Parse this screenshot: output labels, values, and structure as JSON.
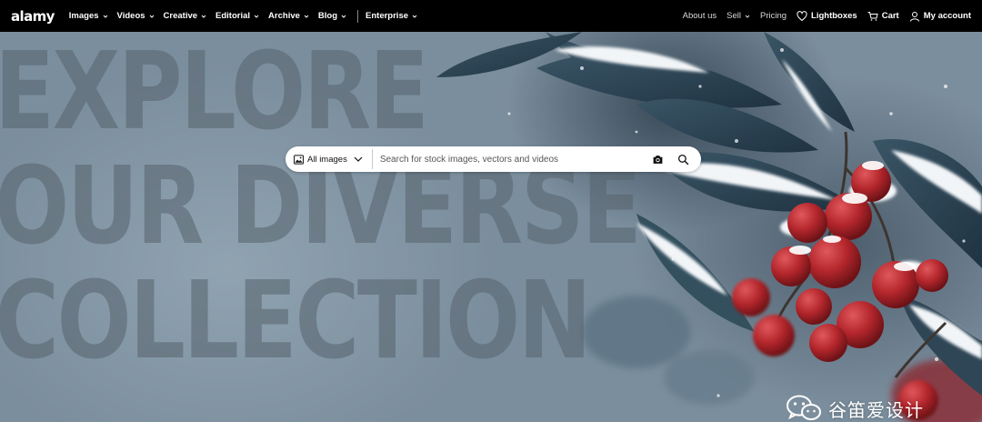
{
  "brand": {
    "logo_text": "alamy"
  },
  "nav": {
    "left": [
      {
        "label": "Images",
        "dropdown": true
      },
      {
        "label": "Videos",
        "dropdown": true
      },
      {
        "label": "Creative",
        "dropdown": true
      },
      {
        "label": "Editorial",
        "dropdown": true
      },
      {
        "label": "Archive",
        "dropdown": true
      },
      {
        "label": "Blog",
        "dropdown": true
      },
      {
        "label": "Enterprise",
        "dropdown": true
      }
    ],
    "right": {
      "about": "About us",
      "sell": "Sell",
      "pricing": "Pricing",
      "lightboxes": "Lightboxes",
      "cart": "Cart",
      "account": "My account"
    }
  },
  "hero": {
    "headline_lines": [
      "EXPLORE",
      "OUR DIVERSE",
      "COLLECTION"
    ]
  },
  "search": {
    "type_label": "All images",
    "placeholder": "Search for stock images, vectors and videos",
    "value": ""
  },
  "icons": {
    "images": "image-icon",
    "camera": "camera-icon",
    "search": "search-icon",
    "heart": "heart-icon",
    "cart": "cart-icon",
    "user": "user-icon"
  },
  "watermark": {
    "text": "谷笛爱设计"
  },
  "colors": {
    "nav_bg": "#000000",
    "berry_red": "#b3262c",
    "hero_blue": "#7e919f"
  }
}
